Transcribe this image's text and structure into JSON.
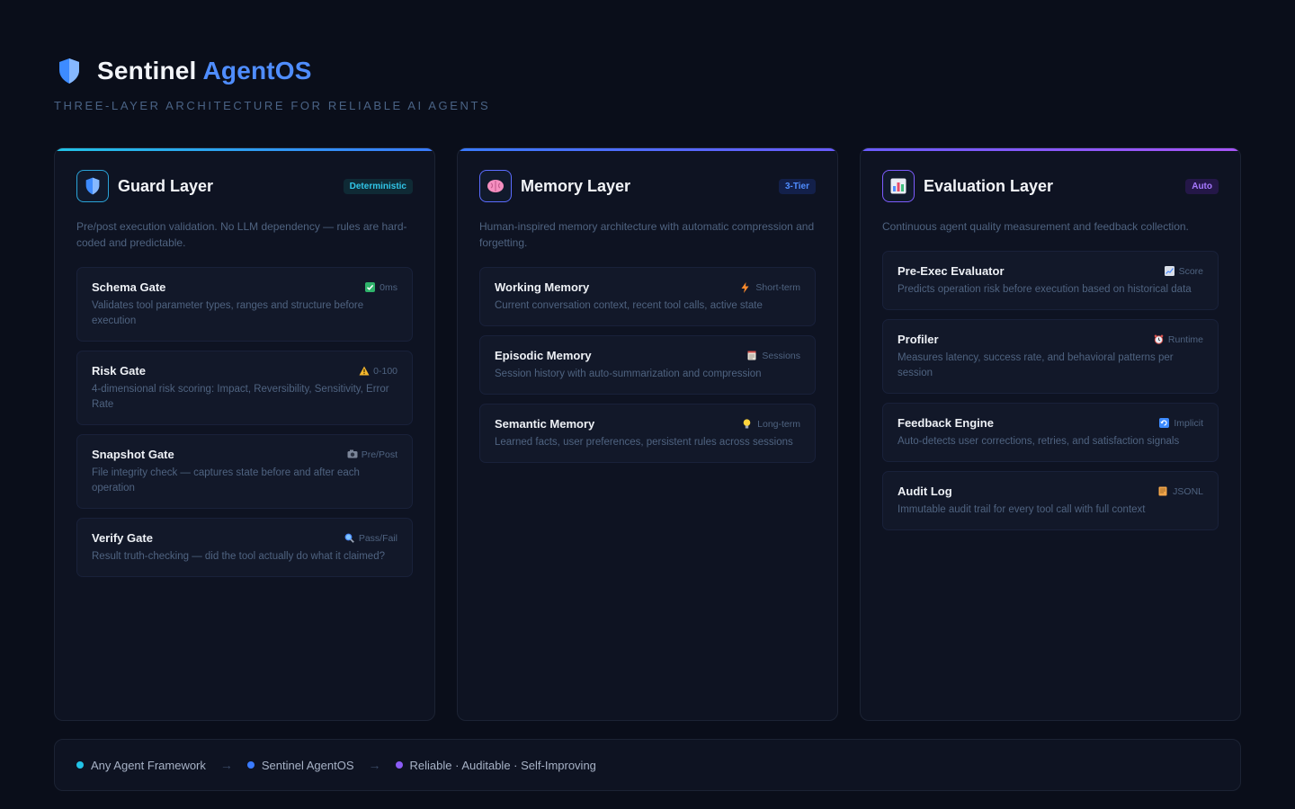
{
  "header": {
    "title_main": "Sentinel",
    "title_accent": "AgentOS",
    "subtitle": "THREE-LAYER ARCHITECTURE FOR RELIABLE AI AGENTS",
    "logo_icon": "shield-icon"
  },
  "columns": [
    {
      "title": "Guard Layer",
      "badge": "Deterministic",
      "icon": "shield-icon",
      "description": "Pre/post execution validation. No LLM dependency — rules are hard-coded and predictable.",
      "items": [
        {
          "name": "Schema Gate",
          "tag": "0ms",
          "tag_icon": "check-icon",
          "desc": "Validates tool parameter types, ranges and structure before execution"
        },
        {
          "name": "Risk Gate",
          "tag": "0-100",
          "tag_icon": "warning-icon",
          "desc": "4-dimensional risk scoring: Impact, Reversibility, Sensitivity, Error Rate"
        },
        {
          "name": "Snapshot Gate",
          "tag": "Pre/Post",
          "tag_icon": "camera-icon",
          "desc": "File integrity check — captures state before and after each operation"
        },
        {
          "name": "Verify Gate",
          "tag": "Pass/Fail",
          "tag_icon": "magnifier-icon",
          "desc": "Result truth-checking — did the tool actually do what it claimed?"
        }
      ]
    },
    {
      "title": "Memory Layer",
      "badge": "3-Tier",
      "icon": "brain-icon",
      "description": "Human-inspired memory architecture with automatic compression and forgetting.",
      "items": [
        {
          "name": "Working Memory",
          "tag": "Short-term",
          "tag_icon": "lightning-icon",
          "desc": "Current conversation context, recent tool calls, active state"
        },
        {
          "name": "Episodic Memory",
          "tag": "Sessions",
          "tag_icon": "notepad-icon",
          "desc": "Session history with auto-summarization and compression"
        },
        {
          "name": "Semantic Memory",
          "tag": "Long-term",
          "tag_icon": "bulb-icon",
          "desc": "Learned facts, user preferences, persistent rules across sessions"
        }
      ]
    },
    {
      "title": "Evaluation Layer",
      "badge": "Auto",
      "icon": "bar-chart-icon",
      "description": "Continuous agent quality measurement and feedback collection.",
      "items": [
        {
          "name": "Pre-Exec Evaluator",
          "tag": "Score",
          "tag_icon": "chart-icon",
          "desc": "Predicts operation risk before execution based on historical data"
        },
        {
          "name": "Profiler",
          "tag": "Runtime",
          "tag_icon": "alarm-clock-icon",
          "desc": "Measures latency, success rate, and behavioral patterns per session"
        },
        {
          "name": "Feedback Engine",
          "tag": "Implicit",
          "tag_icon": "refresh-icon",
          "desc": "Auto-detects user corrections, retries, and satisfaction signals"
        },
        {
          "name": "Audit Log",
          "tag": "JSONL",
          "tag_icon": "scroll-icon",
          "desc": "Immutable audit trail for every tool call with full context"
        }
      ]
    }
  ],
  "footer": {
    "steps": [
      {
        "label": "Any Agent Framework",
        "color": "#22c3e6"
      },
      {
        "label": "Sentinel AgentOS",
        "color": "#3a7bff"
      },
      {
        "label": "Reliable · Auditable · Self-Improving",
        "color": "#8b5cf6"
      }
    ],
    "arrow": "→"
  }
}
